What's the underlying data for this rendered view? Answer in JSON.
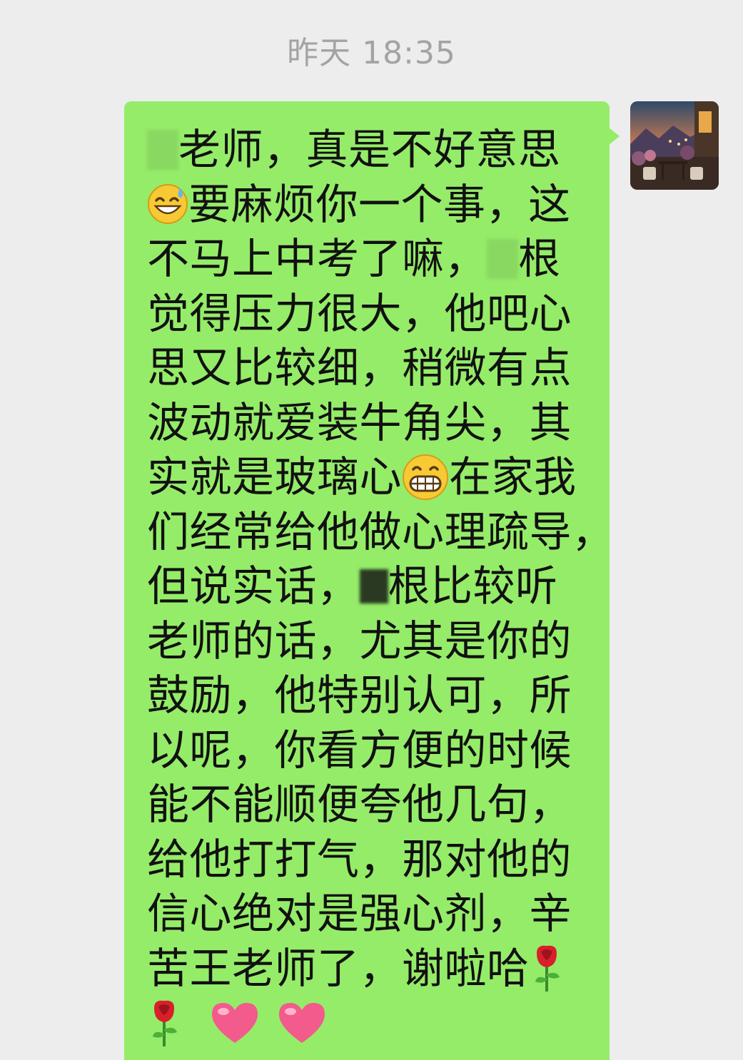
{
  "timestamp": "昨天 18:35",
  "message": {
    "sender": "self",
    "avatar_icon": "patio-garden-photo",
    "bubble_color": "#95ec69",
    "lines": [
      {
        "before": "",
        "redacted_before": true,
        "text": "老师，真是不好意思"
      },
      {
        "emoji": "grinning-sweat-emoji",
        "text": "要麻烦你一个事，这"
      },
      {
        "text": "不马上中考了嘛，",
        "redacted_after": true,
        "after": "根"
      },
      {
        "text": "觉得压力很大，他吧心"
      },
      {
        "text": "思又比较细，稍微有点"
      },
      {
        "text": "波动就爱装牛角尖，其"
      },
      {
        "text": "实就是玻璃心",
        "emoji_after": "grinning-big-teeth-emoji",
        "after": "在家我"
      },
      {
        "text": "们经常给他做心理疏导，"
      },
      {
        "text": "但说实话，",
        "redacted_after": true,
        "after": "根比较听"
      },
      {
        "text": "老师的话，尤其是你的"
      },
      {
        "text": "鼓励，他特别认可，所"
      },
      {
        "text": "以呢，你看方便的时候"
      },
      {
        "text": "能不能顺便夸他几句，"
      },
      {
        "text": "给他打打气，那对他的"
      },
      {
        "text": "信心绝对是强心剂，辛"
      },
      {
        "text": "苦王老师了，谢啦哈",
        "emoji_after": "rose-emoji"
      },
      {
        "emojis": [
          "rose-emoji",
          "heart-emoji",
          "heart-emoji"
        ]
      }
    ]
  }
}
